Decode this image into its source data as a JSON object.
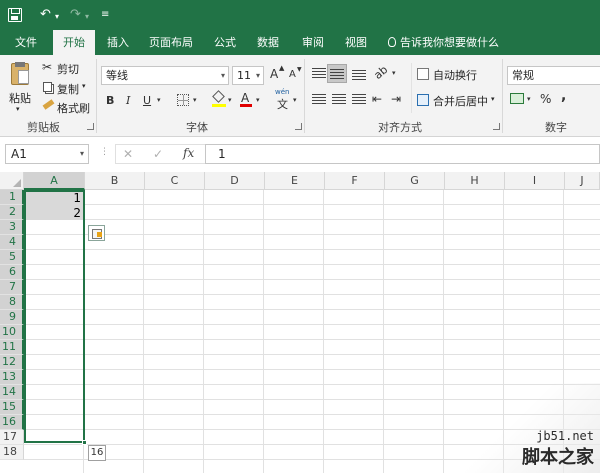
{
  "qat": {
    "save_icon": "save-icon",
    "undo_glyph": "↶",
    "redo_glyph": "↷",
    "dropdown_glyph": "▾",
    "customize_glyph": "≡"
  },
  "tabs": [
    {
      "label": "文件"
    },
    {
      "label": "开始",
      "active": true
    },
    {
      "label": "插入"
    },
    {
      "label": "页面布局"
    },
    {
      "label": "公式"
    },
    {
      "label": "数据"
    },
    {
      "label": "审阅"
    },
    {
      "label": "视图"
    }
  ],
  "tell_me": "告诉我你想要做什么",
  "ribbon": {
    "clipboard": {
      "paste": "粘贴",
      "cut": "剪切",
      "copy": "复制",
      "format_painter": "格式刷",
      "group_label": "剪贴板"
    },
    "font": {
      "font_name": "等线",
      "font_size": "11",
      "grow": "A",
      "shrink": "A",
      "bold": "B",
      "italic": "I",
      "underline": "U",
      "wen": "wén",
      "wen_char": "文",
      "highlight_letter": "A",
      "group_label": "字体"
    },
    "alignment": {
      "wrap_text": "自动换行",
      "merge_center": "合并后居中",
      "group_label": "对齐方式"
    },
    "number": {
      "format": "常规",
      "percent": "%",
      "comma": ",",
      "group_label": "数字"
    }
  },
  "formula_bar": {
    "name_box": "A1",
    "cancel": "✕",
    "enter": "✓",
    "fx": "fx",
    "value": "1"
  },
  "columns": [
    "A",
    "B",
    "C",
    "D",
    "E",
    "F",
    "G",
    "H",
    "I",
    "J"
  ],
  "rows": [
    "1",
    "2",
    "3",
    "4",
    "5",
    "6",
    "7",
    "8",
    "9",
    "10",
    "11",
    "12",
    "13",
    "14",
    "15",
    "16",
    "17",
    "18"
  ],
  "cells": {
    "A1": "1",
    "A2": "2"
  },
  "fill_tooltip": "16",
  "watermark": {
    "url": "jb51.net",
    "text": "脚本之家"
  },
  "colors": {
    "accent": "#217346",
    "selection": "#d9d9d9"
  }
}
